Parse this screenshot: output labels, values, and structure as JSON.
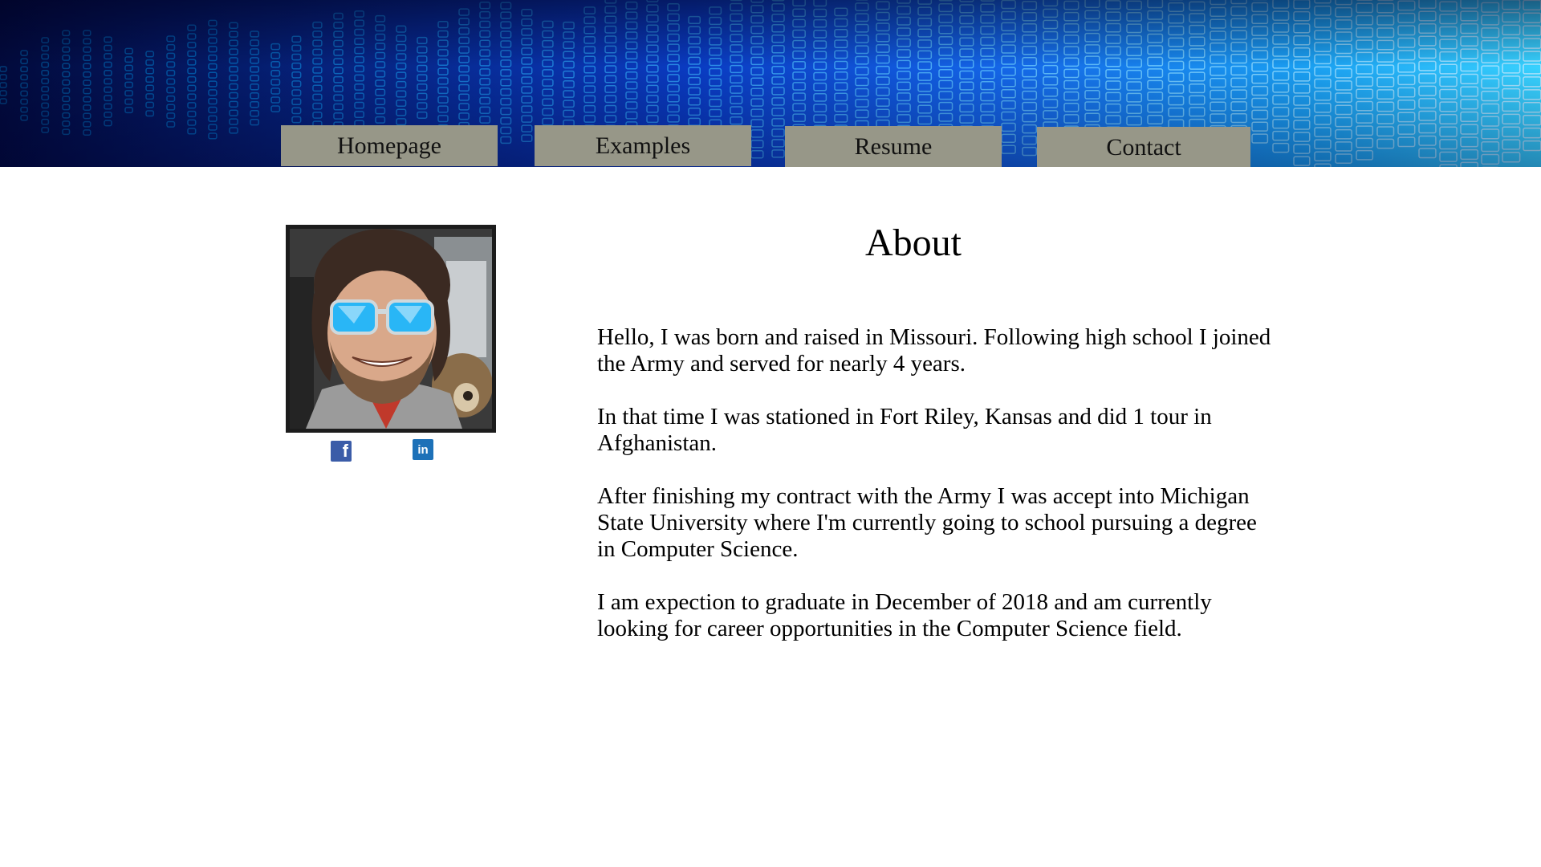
{
  "nav": {
    "items": [
      {
        "label": "Homepage"
      },
      {
        "label": "Examples"
      },
      {
        "label": "Resume"
      },
      {
        "label": "Contact"
      }
    ]
  },
  "profile": {
    "photo_icon": "profile-photo",
    "social": [
      {
        "icon": "facebook-icon",
        "glyph": "f"
      },
      {
        "icon": "linkedin-icon",
        "glyph": "in"
      }
    ]
  },
  "about": {
    "title": "About",
    "paragraphs": [
      "Hello, I was born and raised in Missouri. Following high school I joined the Army and served for nearly 4 years.",
      "In that time I was stationed in Fort Riley, Kansas and did 1 tour in Afghanistan.",
      "After finishing my contract with the Army I was accept into Michigan State University where I'm currently going to school pursuing a degree in Computer Science.",
      "I am expection to graduate in December of 2018 and am currently looking for career opportunities in the Computer Science field."
    ]
  },
  "colors": {
    "nav_button": "#979788",
    "banner_dark": "#020a3c",
    "banner_light": "#38d2ff",
    "facebook": "#3b5ca8",
    "linkedin": "#1d71b8"
  }
}
